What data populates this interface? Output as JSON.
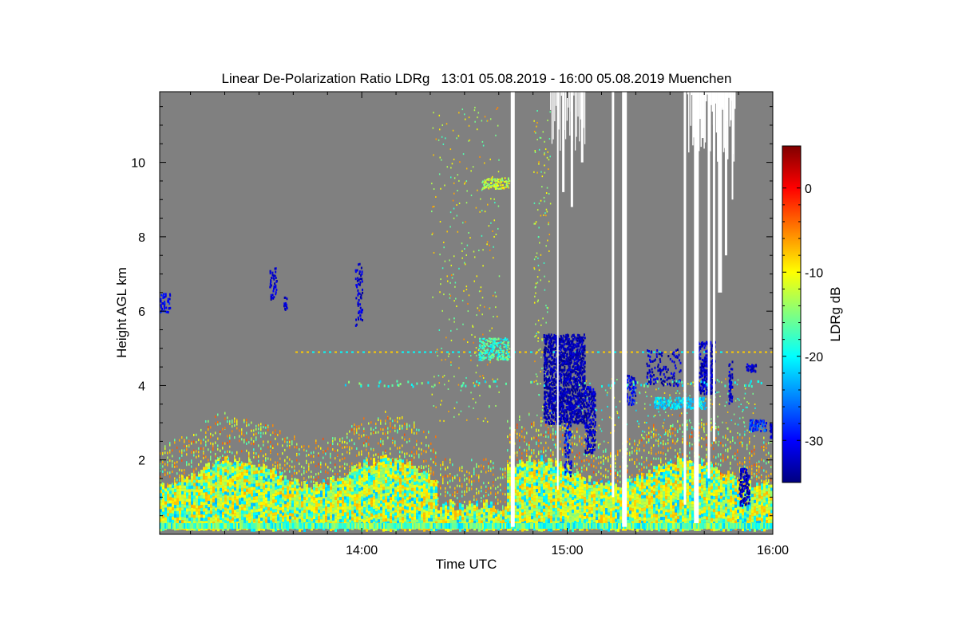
{
  "chart_data": {
    "type": "heatmap",
    "title": "Linear De-Polarization Ratio LDRg   13:01 05.08.2019 - 16:00 05.08.2019 Muenchen",
    "xlabel": "Time UTC",
    "ylabel": "Height AGL km",
    "xlim": [
      "13:01",
      "16:00"
    ],
    "ylim": [
      0,
      11.9
    ],
    "x_ticks": [
      "14:00",
      "15:00",
      "16:00"
    ],
    "y_ticks": [
      "2",
      "4",
      "6",
      "8",
      "10"
    ],
    "colorbar": {
      "label": "LDRg dB",
      "range": [
        -35,
        5
      ],
      "ticks": [
        "0",
        "-10",
        "-20",
        "-30"
      ],
      "colors": [
        "#00007f",
        "#0000ff",
        "#0080ff",
        "#00ffff",
        "#80ff80",
        "#ffff00",
        "#ff8000",
        "#ff0000",
        "#800000"
      ]
    },
    "background_color": "#808080",
    "no_data_color": "#ffffff"
  }
}
